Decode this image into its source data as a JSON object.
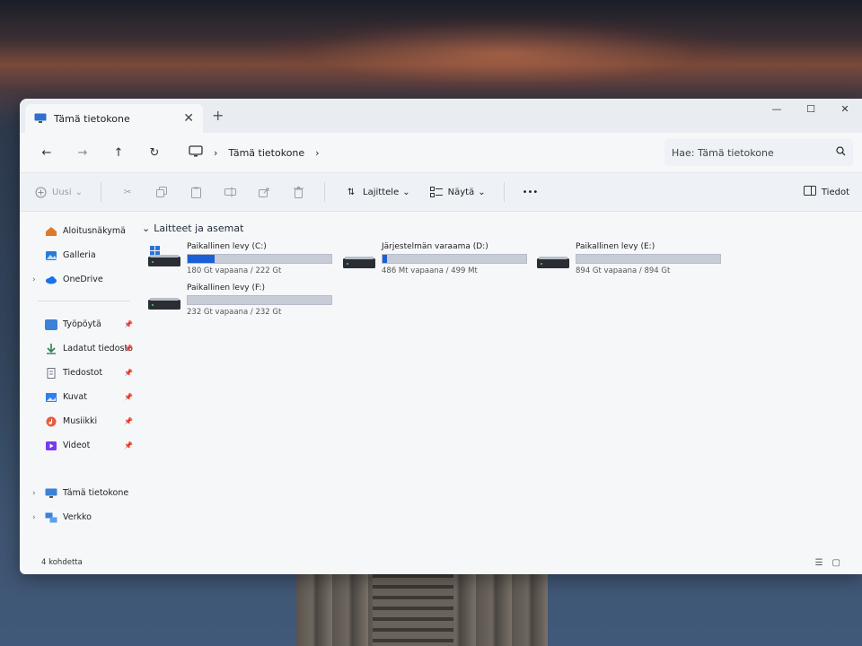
{
  "window": {
    "tab_title": "Tämä tietokone",
    "tab_close": "✕",
    "new_tab": "+",
    "minimize": "—",
    "maximize": "☐",
    "close": "✕"
  },
  "address": {
    "breadcrumb": [
      "Tämä tietokone"
    ],
    "search_placeholder": "Hae: Tämä tietokone"
  },
  "toolbar": {
    "new_label": "Uusi",
    "sort_label": "Lajittele",
    "view_label": "Näytä",
    "more_label": "•••",
    "details_label": "Tiedot"
  },
  "sidebar": {
    "top_items": [
      {
        "label": "Aloitusnäkymä",
        "icon": "home-icon",
        "color": "#e0782c"
      },
      {
        "label": "Galleria",
        "icon": "gallery-icon",
        "color": "#2a7ad8"
      },
      {
        "label": "OneDrive",
        "icon": "cloud-icon",
        "color": "#1a73e8"
      }
    ],
    "pinned_items": [
      {
        "label": "Työpöytä",
        "icon": "desktop-icon",
        "color": "#3b82d6"
      },
      {
        "label": "Ladatut tiedosto",
        "icon": "download-icon",
        "color": "#2e7d4f"
      },
      {
        "label": "Tiedostot",
        "icon": "documents-icon",
        "color": "#6b7280"
      },
      {
        "label": "Kuvat",
        "icon": "pictures-icon",
        "color": "#2f80ed"
      },
      {
        "label": "Musiikki",
        "icon": "music-icon",
        "color": "#e85d3a"
      },
      {
        "label": "Videot",
        "icon": "videos-icon",
        "color": "#7c3aed"
      }
    ],
    "bottom_items": [
      {
        "label": "Tämä tietokone",
        "icon": "computer-icon",
        "color": "#3b82d6"
      },
      {
        "label": "Verkko",
        "icon": "network-icon",
        "color": "#3b82d6"
      }
    ]
  },
  "main": {
    "section_title": "Laitteet ja asemat",
    "drives": [
      {
        "name": "Paikallinen levy (C:)",
        "free_text": "180 Gt vapaana / 222 Gt",
        "used_fraction": 0.19,
        "windows_logo": true
      },
      {
        "name": "Järjestelmän varaama (D:)",
        "free_text": "486 Mt vapaana / 499 Mt",
        "used_fraction": 0.03,
        "windows_logo": false
      },
      {
        "name": "Paikallinen levy (E:)",
        "free_text": "894 Gt vapaana / 894 Gt",
        "used_fraction": 0.0,
        "windows_logo": false
      },
      {
        "name": "Paikallinen levy (F:)",
        "free_text": "232 Gt vapaana / 232 Gt",
        "used_fraction": 0.0,
        "windows_logo": false
      }
    ]
  },
  "status": {
    "item_count": "4 kohdetta"
  },
  "colors": {
    "accent": "#1a5fd6",
    "bar_track": "#c8ccd6"
  }
}
